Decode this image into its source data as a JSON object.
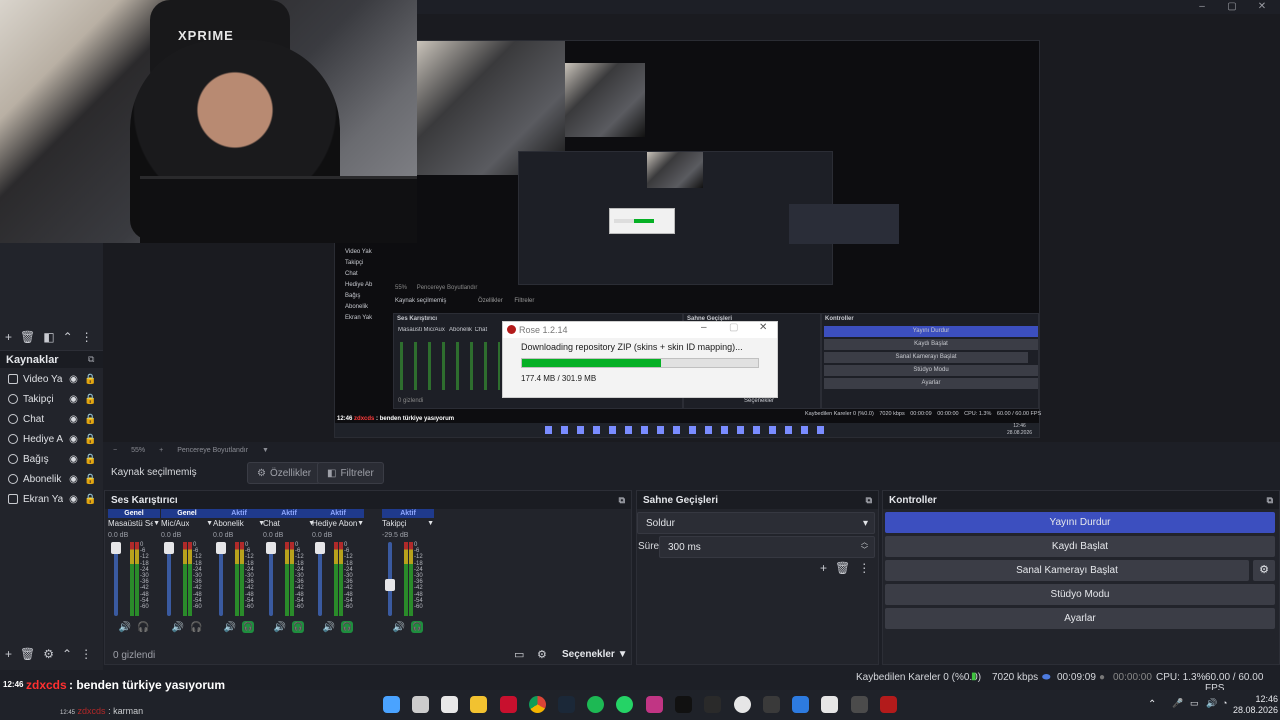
{
  "window": {
    "minimize": "–",
    "maximize": "▢",
    "close": "✕"
  },
  "webcam": {
    "chair_logo": "XPRIME"
  },
  "sources": {
    "title": "Kaynaklar",
    "items": [
      {
        "label": "Video Yak",
        "icon": "camera-icon"
      },
      {
        "label": "Takipçi",
        "icon": "globe-icon"
      },
      {
        "label": "Chat",
        "icon": "globe-icon"
      },
      {
        "label": "Hediye Ab",
        "icon": "globe-icon"
      },
      {
        "label": "Bağış",
        "icon": "globe-icon"
      },
      {
        "label": "Abonelik",
        "icon": "globe-icon"
      },
      {
        "label": "Ekran Yak",
        "icon": "monitor-icon"
      }
    ]
  },
  "zoom": {
    "value": "55%",
    "minus": "−",
    "plus": "+",
    "mode": "Pencereye Boyutlandır"
  },
  "propbar": {
    "no_source": "Kaynak seçilmemiş",
    "properties": "Özellikler",
    "filters": "Filtreler"
  },
  "mixer": {
    "title": "Ses Karıştırıcı",
    "scale": [
      "0",
      "-6",
      "-12",
      "-18",
      "-24",
      "-30",
      "-36",
      "-42",
      "-48",
      "-54",
      "-60"
    ],
    "channels": [
      {
        "tag": "Genel",
        "name": "Masaüstü Ses",
        "db": "0.0 dB",
        "level": 0
      },
      {
        "tag": "Genel",
        "name": "Mic/Aux",
        "db": "0.0 dB",
        "level": 0
      },
      {
        "tag": "Aktif",
        "name": "Abonelik",
        "db": "0.0 dB",
        "level": 0
      },
      {
        "tag": "Aktif",
        "name": "Chat",
        "db": "0.0 dB",
        "level": 0
      },
      {
        "tag": "Aktif",
        "name": "Hediye Abonelik",
        "db": "0.0 dB",
        "level": 0
      },
      {
        "tag": "Aktif",
        "name": "Takipçi",
        "db": "-29.5 dB",
        "level": 0.6
      }
    ],
    "hidden": "0 gizlendi",
    "options": "Seçenekler"
  },
  "transitions": {
    "title": "Sahne Geçişleri",
    "selected": "Soldur",
    "duration_label": "Süre",
    "duration": "300 ms"
  },
  "controls": {
    "title": "Kontroller",
    "stop_stream": "Yayını Durdur",
    "start_record": "Kaydı Başlat",
    "virtual_cam": "Sanal Kamerayı Başlat",
    "studio": "Stüdyo Modu",
    "settings": "Ayarlar"
  },
  "status": {
    "dropped": "Kaybedilen Kareler 0 (%0.0)",
    "bitrate": "7020 kbps",
    "stream_time": "00:09:09",
    "rec_time": "00:00:00",
    "cpu": "CPU: 1.3%",
    "fps": "60.00 / 60.00 FPS"
  },
  "chat": {
    "time": "12:46",
    "user": "zdxcds",
    "message": ": benden türkiye yasıyorum",
    "ghost_time": "12:45",
    "ghost_user": "zdxcds",
    "ghost_message": ": karman"
  },
  "rose": {
    "title": "Rose 1.2.14",
    "message": "Downloading repository ZIP (skins + skin ID mapping)...",
    "progress": 0.59,
    "size": "177.4 MB / 301.9 MB"
  },
  "inner_preview": {
    "zoom": "55%",
    "zoom_mode": "Pencereye Boyutlandır",
    "no_source": "Kaynak seçilmemiş",
    "properties": "Özellikler",
    "filters": "Filtreler",
    "mixer_title": "Ses Karıştırıcı",
    "transitions_title": "Sahne Geçişleri",
    "controls_title": "Kontroller",
    "mixer_cols": [
      "Masaüstü Ses",
      "Mic/Aux",
      "Abonelik",
      "Chat"
    ],
    "hidden": "0 gizlendi",
    "options": "Seçenekler",
    "btn_stop": "Yayını Durdur",
    "btn_rec": "Kaydı Başlat",
    "btn_vcam": "Sanal Kamerayı Başlat",
    "btn_studio": "Stüdyo Modu",
    "btn_settings": "Ayarlar",
    "status": "Kaybedilen Kareler 0 (%0.0)",
    "bitrate": "7020 kbps",
    "stream_time": "00:00:09",
    "rec_time": "00:00:00",
    "cpu": "CPU: 1.3%",
    "fps": "60.00 / 60.00 FPS",
    "clock_time": "12:46",
    "clock_date": "28.08.2026",
    "sources": [
      "Video Yak",
      "Takipçi",
      "Chat",
      "Hediye Ab",
      "Bağış",
      "Abonelik",
      "Ekran Yak"
    ]
  },
  "clock": {
    "time": "12:46",
    "date": "28.08.2026"
  }
}
